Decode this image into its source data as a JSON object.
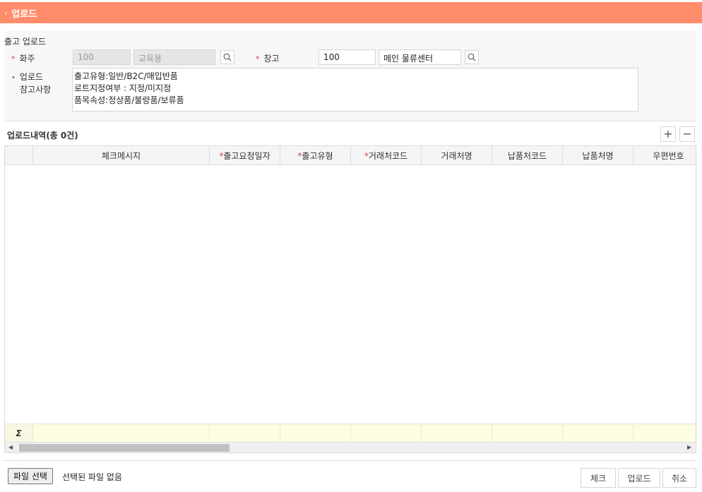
{
  "header": {
    "title": "업로드"
  },
  "form": {
    "section_title": "출고 업로드",
    "owner": {
      "label": "화주",
      "code": "100",
      "name": "교육용"
    },
    "warehouse": {
      "label": "창고",
      "code": "100",
      "name": "메인 물류센터"
    },
    "notes": {
      "label_line1": "업로드",
      "label_line2": "참고사항",
      "text": "출고유형:일반/B2C/매입반품\n로트지정여부 : 지정/미지정\n품목속성:정상품/불량품/보류품"
    }
  },
  "grid": {
    "title": "업로드내역(총 0건)",
    "add_label": "+",
    "remove_label": "−",
    "columns": [
      {
        "label": "체크메시지",
        "required": false
      },
      {
        "label": "출고요청일자",
        "required": true
      },
      {
        "label": "출고유형",
        "required": true
      },
      {
        "label": "거래처코드",
        "required": true
      },
      {
        "label": "거래처명",
        "required": false
      },
      {
        "label": "납품처코드",
        "required": false
      },
      {
        "label": "납품처명",
        "required": false
      },
      {
        "label": "우편번호",
        "required": false
      }
    ],
    "footer_symbol": "Σ",
    "rows": []
  },
  "footer": {
    "file_button": "파일 선택",
    "file_status": "선택된 파일 없음",
    "check_button": "체크",
    "upload_button": "업로드",
    "cancel_button": "취소"
  },
  "colors": {
    "header_bg": "#ff8c6b",
    "required": "#e23b3b",
    "footer_row": "#fdfde0"
  }
}
